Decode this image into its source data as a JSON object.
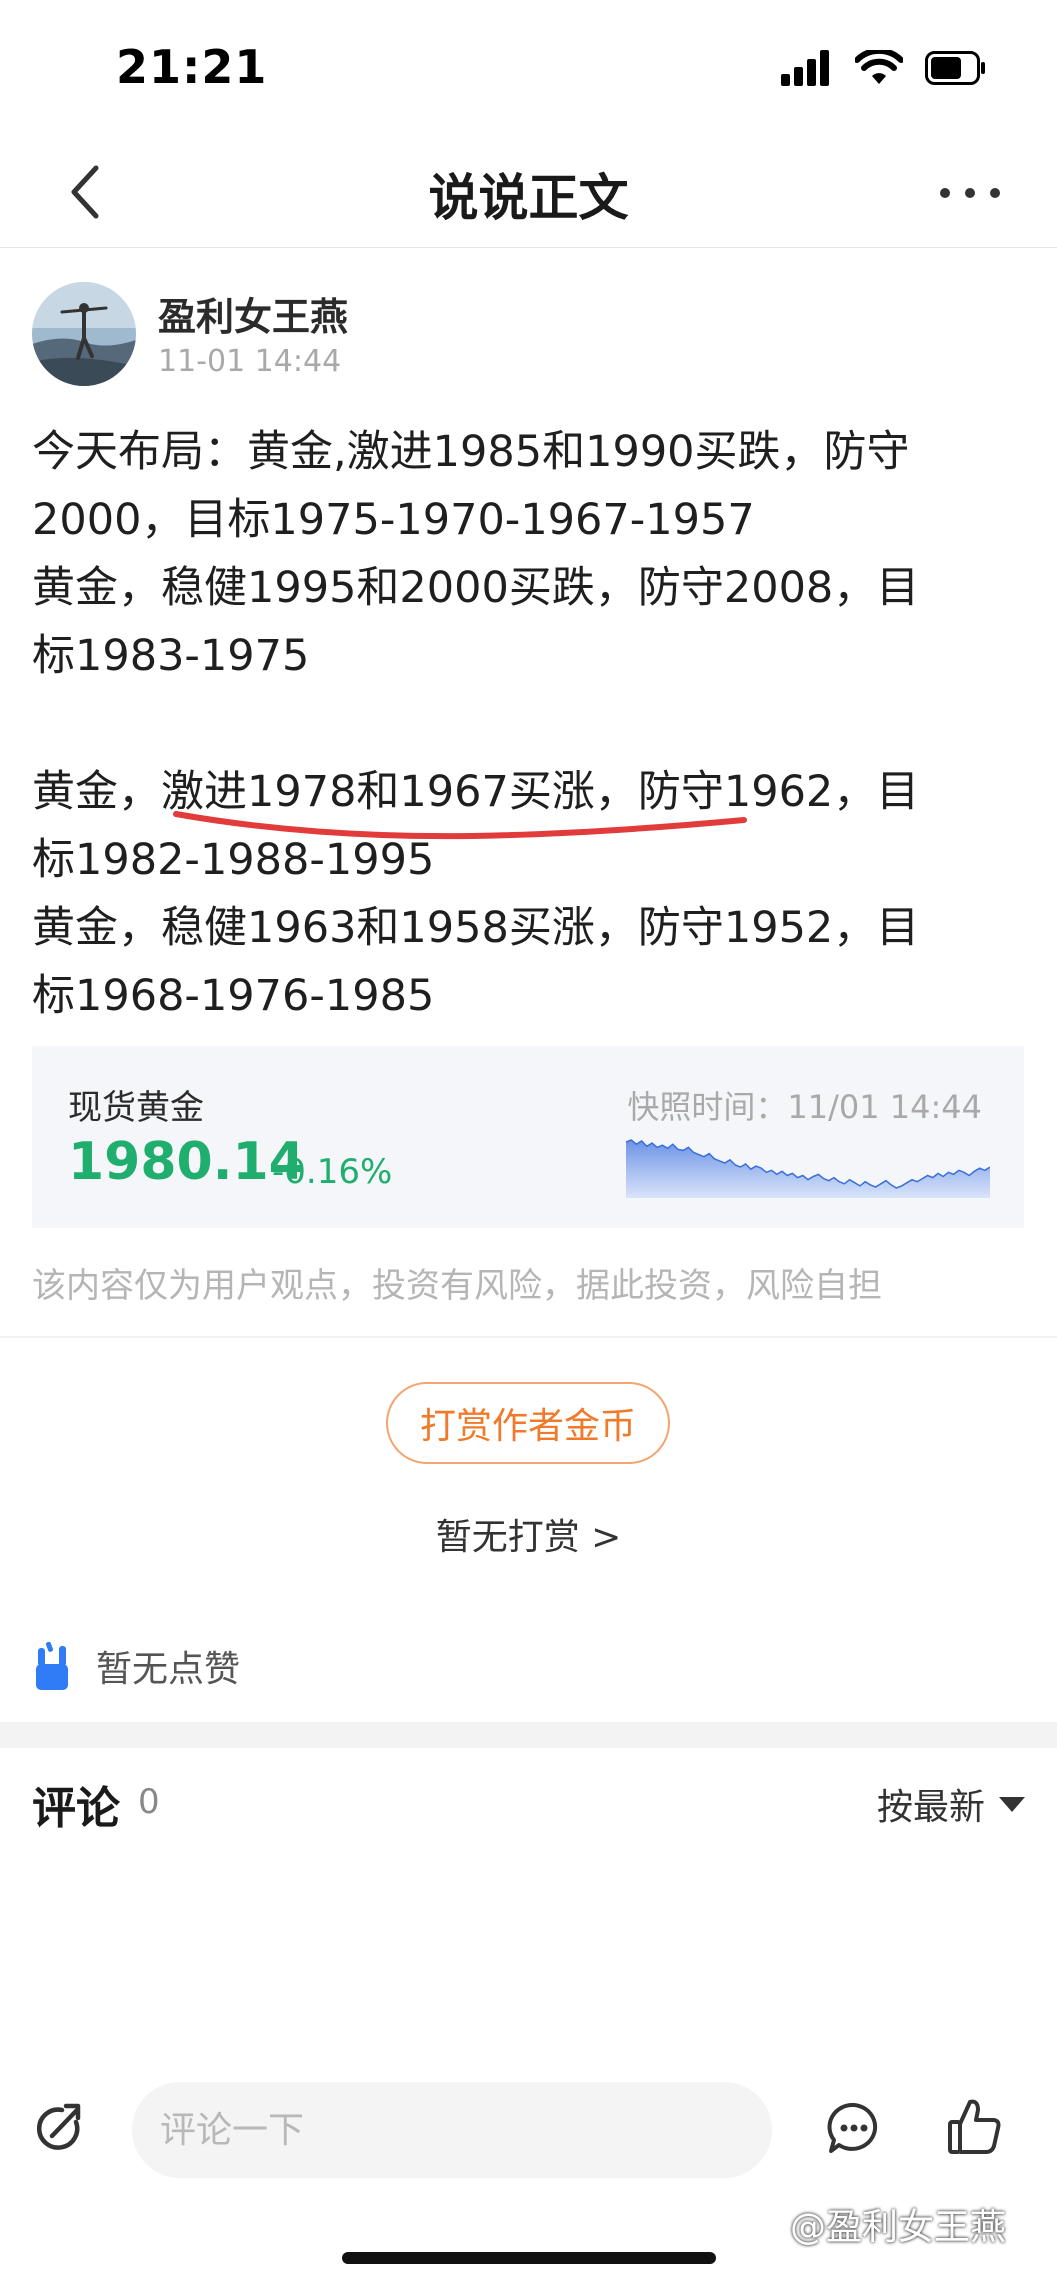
{
  "status_bar": {
    "time": "21:21"
  },
  "nav": {
    "title": "说说正文"
  },
  "author": {
    "name": "盈利女王燕",
    "time": "11-01 14:44"
  },
  "post": {
    "lines": [
      "今天布局：黄金,激进1985和1990买跌，防守",
      "2000，目标1975-1970-1967-1957",
      "黄金，稳健1995和2000买跌，防守2008，目",
      "标1983-1975",
      "",
      "黄金，激进1978和1967买涨，防守1962，目",
      "标1982-1988-1995",
      "黄金，稳健1963和1958买涨，防守1952，目",
      "标1968-1976-1985"
    ]
  },
  "quote": {
    "name": "现货黄金",
    "price": "1980.14",
    "change": "-0.16%",
    "snapshot": "快照时间：11/01 14:44",
    "color": "#1fae6e",
    "sparkline": [
      62,
      64,
      60,
      63,
      58,
      61,
      57,
      59,
      56,
      60,
      55,
      54,
      57,
      52,
      50,
      48,
      51,
      46,
      44,
      42,
      45,
      40,
      38,
      41,
      36,
      39,
      37,
      33,
      35,
      31,
      34,
      30,
      32,
      28,
      30,
      26,
      29,
      31,
      27,
      25,
      28,
      24,
      22,
      26,
      23,
      20,
      24,
      21,
      19,
      22,
      25,
      21,
      18,
      20,
      23,
      26,
      24,
      27,
      30,
      28,
      32,
      29,
      33,
      31,
      35,
      33,
      30,
      34,
      37,
      35,
      38
    ]
  },
  "disclaimer": "该内容仅为用户观点，投资有风险，据此投资，风险自担",
  "reward": {
    "button_label": "打赏作者金币",
    "status": "暂无打赏 >"
  },
  "likes": {
    "text": "暂无点赞"
  },
  "comments": {
    "title": "评论",
    "count": "0",
    "sort_label": "按最新"
  },
  "bottom_bar": {
    "placeholder": "评论一下"
  },
  "watermark": "@盈利女王燕",
  "colors": {
    "accent_orange": "#f07a2a",
    "rise_green": "#1fae6e",
    "underline_red": "#e23b3b",
    "like_blue": "#2f7cf6"
  }
}
